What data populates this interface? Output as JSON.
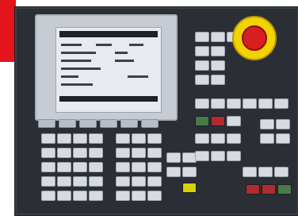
{
  "scene": {
    "colors": {
      "brand_red": "#e3141c",
      "panel": "#2b2f35",
      "screen_bg": "#e7ebf0",
      "key": "#d7dbe1",
      "estop_red": "#d81e1e",
      "estop_yellow": "#f2d200",
      "indicator_green": "#4a7a47",
      "indicator_red": "#b02a2f",
      "indicator_yellow": "#d8d200"
    },
    "icons": [
      "emergency-stop-icon"
    ]
  }
}
